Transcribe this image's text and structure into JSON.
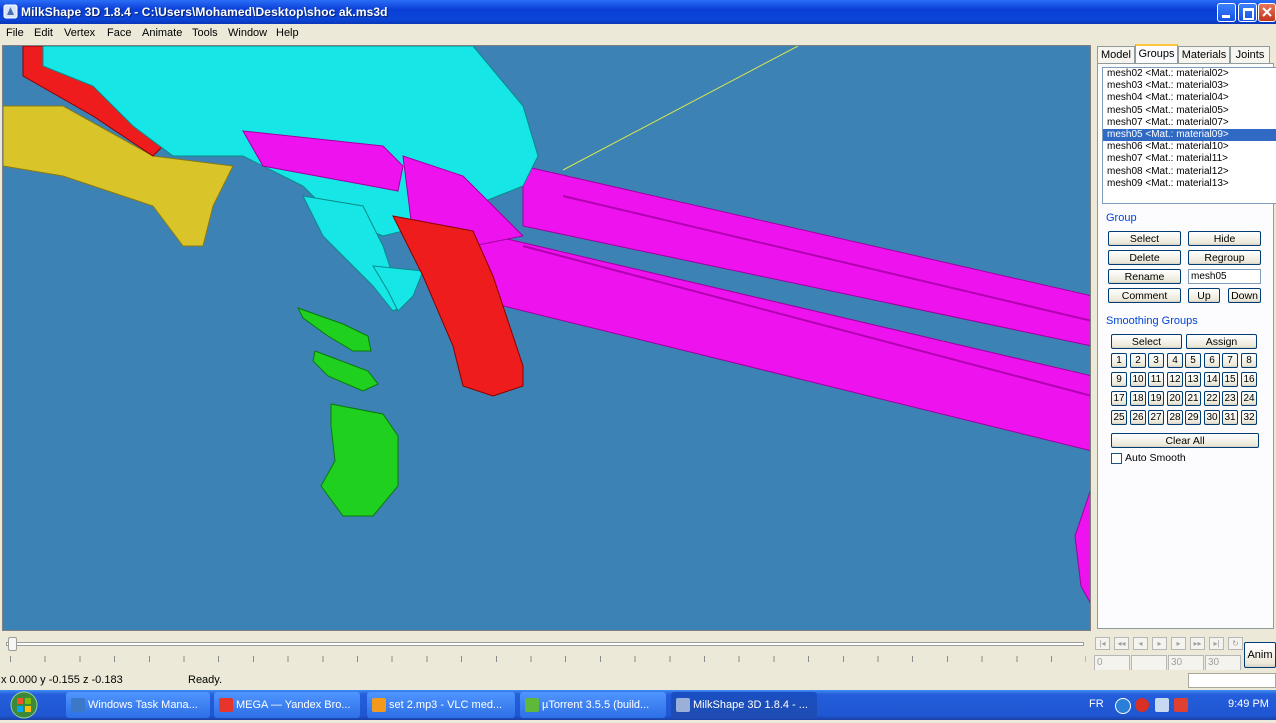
{
  "window": {
    "title": "MilkShape 3D 1.8.4 - C:\\Users\\Mohamed\\Desktop\\shoc ak.ms3d"
  },
  "menu": [
    "File",
    "Edit",
    "Vertex",
    "Face",
    "Animate",
    "Tools",
    "Window",
    "Help"
  ],
  "tabs": [
    "Model",
    "Groups",
    "Materials",
    "Joints"
  ],
  "groups_list": [
    "mesh02 <Mat.: material02>",
    "mesh03 <Mat.: material03>",
    "mesh04 <Mat.: material04>",
    "mesh05 <Mat.: material05>",
    "mesh07 <Mat.: material07>",
    "mesh05 <Mat.: material09>",
    "mesh06 <Mat.: material10>",
    "mesh07 <Mat.: material11>",
    "mesh08 <Mat.: material12>",
    "mesh09 <Mat.: material13>"
  ],
  "group_section": {
    "heading": "Group",
    "select": "Select",
    "hide": "Hide",
    "delete": "Delete",
    "regroup": "Regroup",
    "rename": "Rename",
    "name_value": "mesh05",
    "comment": "Comment",
    "up": "Up",
    "down": "Down"
  },
  "smoothing": {
    "heading": "Smoothing Groups",
    "select": "Select",
    "assign": "Assign",
    "numbers": [
      "1",
      "2",
      "3",
      "4",
      "5",
      "6",
      "7",
      "8",
      "9",
      "10",
      "11",
      "12",
      "13",
      "14",
      "15",
      "16",
      "17",
      "18",
      "19",
      "20",
      "21",
      "22",
      "23",
      "24",
      "25",
      "26",
      "27",
      "28",
      "29",
      "30",
      "31",
      "32"
    ],
    "clear_all": "Clear All",
    "auto_smooth": "Auto Smooth"
  },
  "timeline": {
    "anim": "Anim",
    "frame_start": "0",
    "frame_end": "30",
    "frame_total": "30"
  },
  "status": {
    "coords": "x 0.000 y -0.155 z -0.183",
    "message": "Ready."
  },
  "taskbar": {
    "tasks": [
      {
        "label": "Windows Task Mana...",
        "color": "#3c78c8"
      },
      {
        "label": "MEGA — Yandex Bro...",
        "color": "#e8352c"
      },
      {
        "label": "set 2.mp3 - VLC med...",
        "color": "#f39a1d"
      },
      {
        "label": "µTorrent 3.5.5  (build...",
        "color": "#5fb83a"
      },
      {
        "label": "MilkShape 3D 1.8.4 - ...",
        "color": "#9ab0d8"
      }
    ],
    "lang": "FR",
    "clock": "9:49 PM"
  },
  "colors": {
    "viewport": "#3c82b5",
    "selection": "#316ac5",
    "cyan": "#17e6e6",
    "magenta": "#ee12ee",
    "red": "#ee1c1c",
    "green": "#1fd01f",
    "yellow": "#d9c52a"
  }
}
